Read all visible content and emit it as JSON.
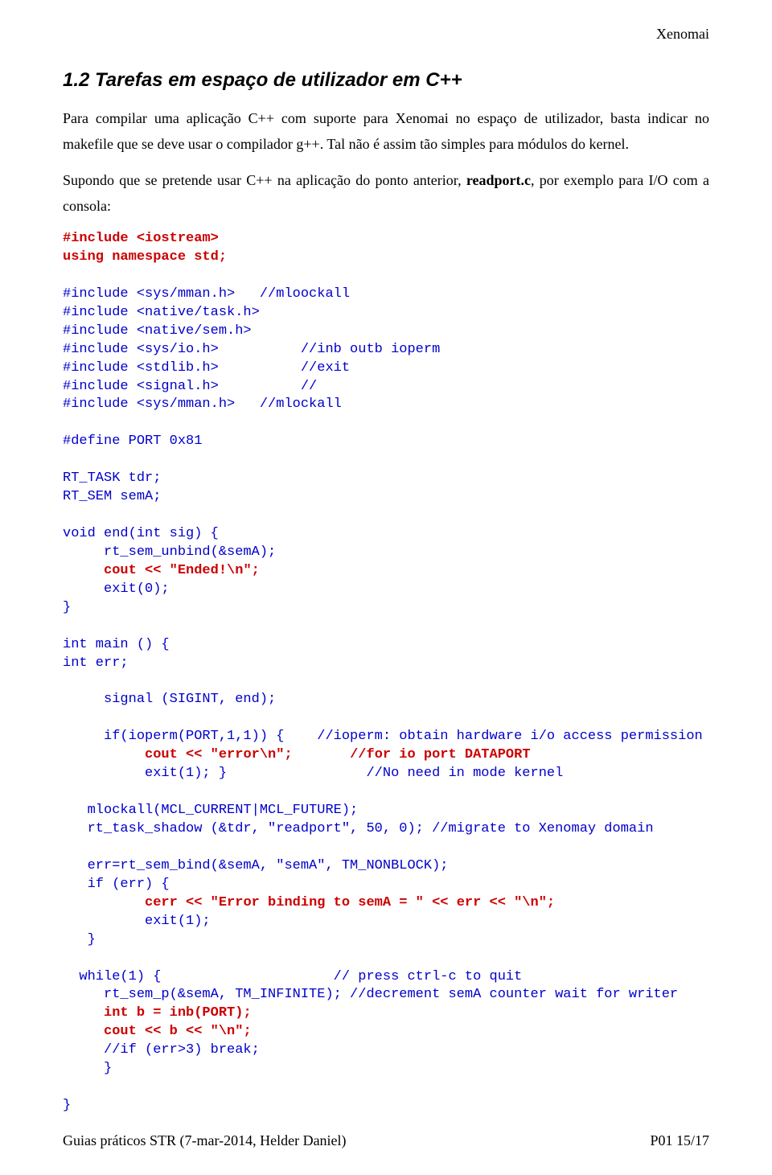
{
  "header": {
    "right": "Xenomai"
  },
  "section": {
    "title": "1.2  Tarefas em espaço de utilizador em C++"
  },
  "para1": {
    "t1": "Para compilar uma aplicação C++ com suporte para Xenomai no espaço de utilizador, basta indicar no makefile que se deve usar o compilador g++. Tal não é assim tão simples para módulos do kernel.",
    "t2a": "Supondo que se pretende usar C++ na aplicação do ponto anterior, ",
    "t2b": "readport.c",
    "t2c": ", por exemplo para I/O com a consola:"
  },
  "code": {
    "l01a": "#include <iostream>",
    "l02a": "using namespace std;",
    "blank1": "",
    "l03": "#include <sys/mman.h>   //mloockall",
    "l04": "#include <native/task.h>",
    "l05": "#include <native/sem.h>",
    "l06": "#include <sys/io.h>          //inb outb ioperm",
    "l07": "#include <stdlib.h>          //exit",
    "l08": "#include <signal.h>          //",
    "l09": "#include <sys/mman.h>   //mlockall",
    "blank2": "",
    "l10": "#define PORT 0x81",
    "blank3": "",
    "l11": "RT_TASK tdr;",
    "l12": "RT_SEM semA;",
    "blank4": "",
    "l13": "void end(int sig) {",
    "l14": "     rt_sem_unbind(&semA);",
    "l15a": "     ",
    "l15b": "cout << \"Ended!\\n\";",
    "l16": "     exit(0);",
    "l17": "}",
    "blank5": "",
    "l18": "int main () {",
    "l19": "int err;",
    "blank6": "",
    "l20": "     signal (SIGINT, end);",
    "blank7": "",
    "l21": "     if(ioperm(PORT,1,1)) {    //ioperm: obtain hardware i/o access permission",
    "l22a": "          ",
    "l22b": "cout << \"error\\n\";",
    "l22c": "       //for io port DATAPORT",
    "l23": "          exit(1); }                 //No need in mode kernel",
    "blank8": "",
    "l24": "   mlockall(MCL_CURRENT|MCL_FUTURE);",
    "l25": "   rt_task_shadow (&tdr, \"readport\", 50, 0); //migrate to Xenomay domain",
    "blank9": "",
    "l26": "   err=rt_sem_bind(&semA, \"semA\", TM_NONBLOCK);",
    "l27": "   if (err) {",
    "l28a": "          ",
    "l28b": "cerr << \"Error binding to semA = \" << err << \"\\n\";",
    "l29": "          exit(1);",
    "l30": "   }",
    "blank10": "",
    "l31": "  while(1) {                     // press ctrl-c to quit",
    "l32": "     rt_sem_p(&semA, TM_INFINITE); //decrement semA counter wait for writer",
    "l33a": "     ",
    "l33b": "int b = inb(PORT);",
    "l34a": "     ",
    "l34b": "cout << b << \"\\n\";",
    "l35": "     //if (err>3) break;",
    "l36": "     }",
    "blank11": "",
    "l37": "}"
  },
  "footer": {
    "left": "Guias práticos STR (7-mar-2014, Helder Daniel)",
    "right": "P01  15/17"
  }
}
